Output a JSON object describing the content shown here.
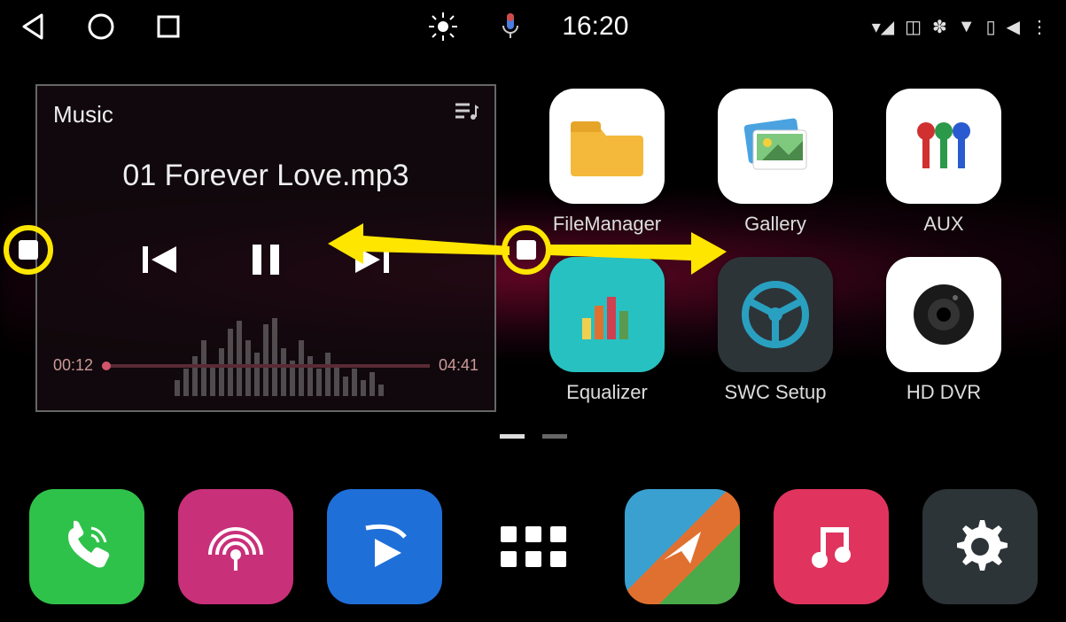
{
  "status": {
    "time": "16:20",
    "indicators": [
      "▾◢",
      "◫",
      "🕽",
      "▼",
      "◫⋯",
      "◀",
      "⋮",
      "⨳"
    ]
  },
  "music": {
    "widget_title": "Music",
    "track": "01 Forever   Love.mp3",
    "elapsed": "00:12",
    "total": "04:41"
  },
  "apps": [
    {
      "label": "FileManager",
      "icon": "folder-icon",
      "bg": "#ffffff"
    },
    {
      "label": "Gallery",
      "icon": "gallery-icon",
      "bg": "#ffffff"
    },
    {
      "label": "AUX",
      "icon": "aux-icon",
      "bg": "#ffffff"
    },
    {
      "label": "Equalizer",
      "icon": "equalizer-icon",
      "bg": "#28c1c1"
    },
    {
      "label": "SWC Setup",
      "icon": "steering-icon",
      "bg": "#2d3438"
    },
    {
      "label": "HD DVR",
      "icon": "camera-icon",
      "bg": "#ffffff"
    }
  ],
  "dock": [
    {
      "name": "phone-app",
      "bg": "#2fc24a"
    },
    {
      "name": "radio-app",
      "bg": "#c9307a"
    },
    {
      "name": "video-app",
      "bg": "#1f6fd9"
    },
    {
      "name": "apps-drawer",
      "bg": "#000000"
    },
    {
      "name": "nav-app",
      "bg": "#3a3f44"
    },
    {
      "name": "music-app",
      "bg": "#e0345e"
    },
    {
      "name": "settings-app",
      "bg": "#2d3438"
    }
  ],
  "page_indicator": {
    "active": 0,
    "count": 2
  }
}
